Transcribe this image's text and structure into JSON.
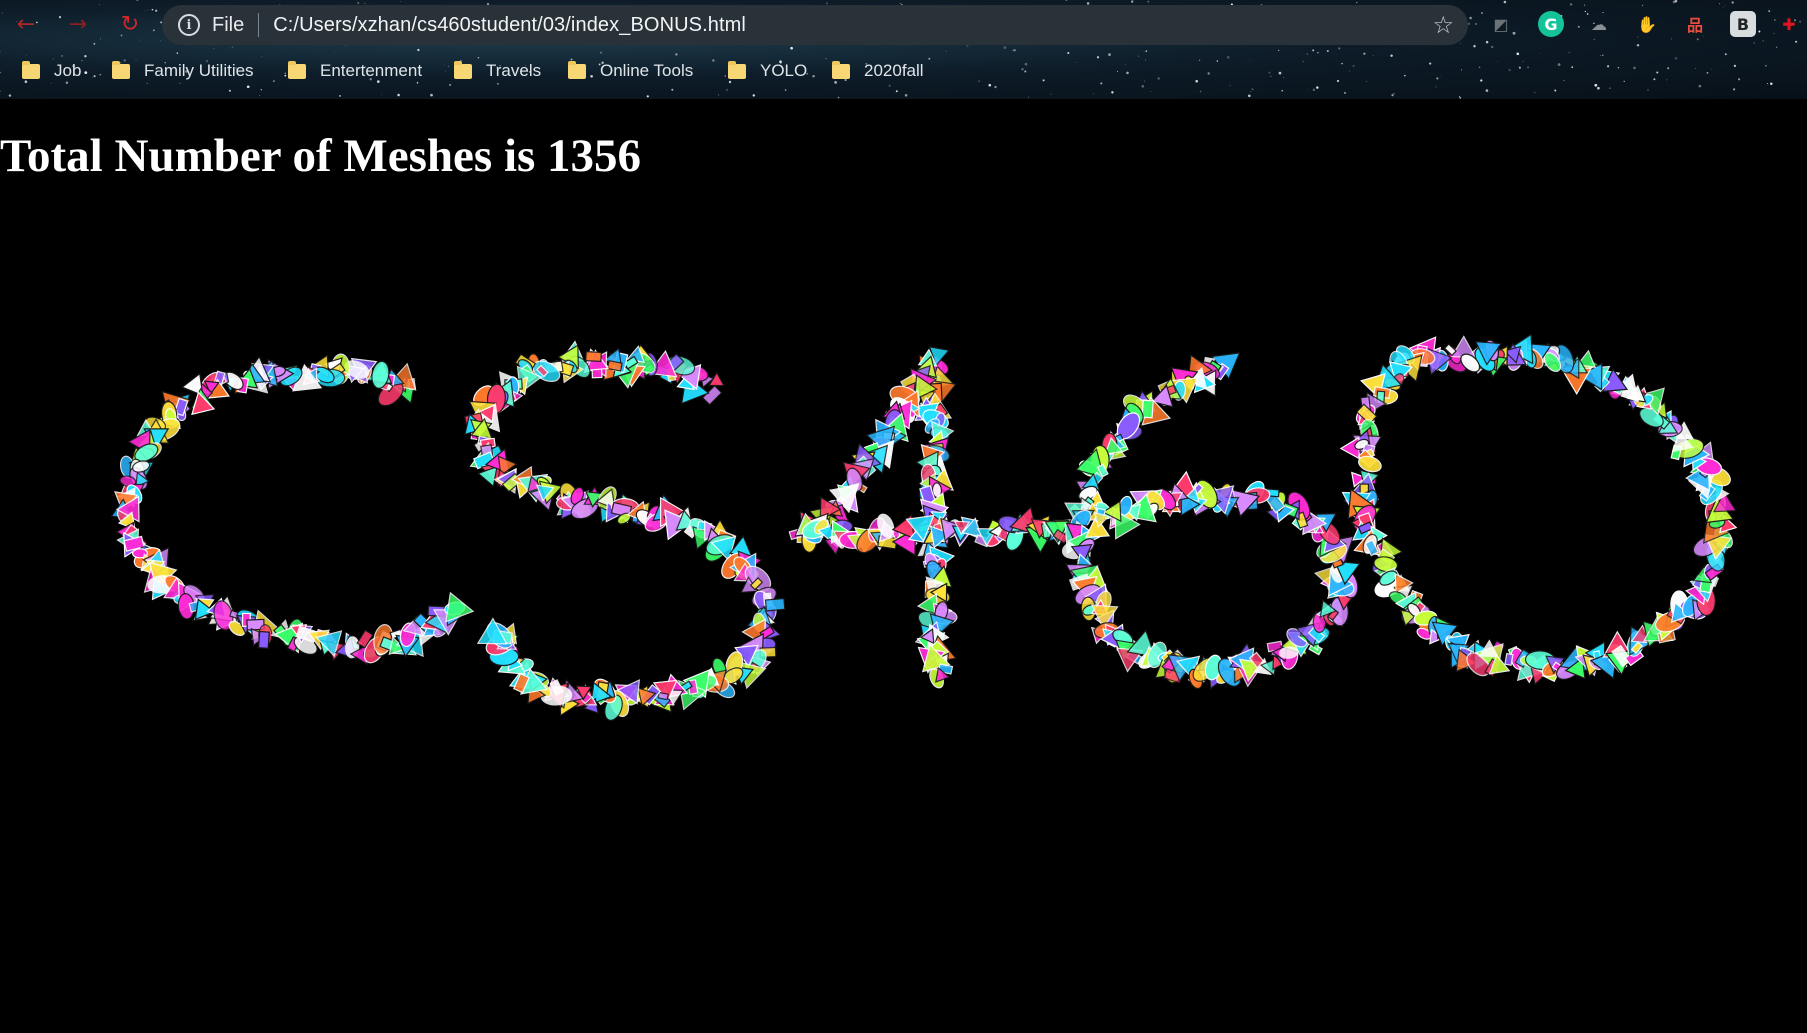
{
  "browser": {
    "scheme_label": "File",
    "url": "C:/Users/xzhan/cs460student/03/index_BONUS.html",
    "nav_icons": [
      "back-arrow-icon",
      "forward-arrow-icon",
      "reload-icon"
    ],
    "extensions": [
      {
        "name": "extension-compass-icon",
        "color": "#6b7378",
        "glyph": "◩"
      },
      {
        "name": "grammarly-icon",
        "color": "#15c39a",
        "glyph": "G"
      },
      {
        "name": "extension-cloud-icon",
        "color": "#8a9096",
        "glyph": "☁"
      },
      {
        "name": "adblock-icon",
        "color": "#d40a0a",
        "glyph": "✋"
      },
      {
        "name": "extension-sitemap-icon",
        "color": "#e84c3d",
        "glyph": "品"
      },
      {
        "name": "extension-b-icon",
        "color": "#d9dcdf",
        "glyph": "B"
      },
      {
        "name": "extensions-puzzle-icon",
        "color": "#e0141e",
        "glyph": "✚"
      }
    ]
  },
  "bookmarks": [
    {
      "label": "Job"
    },
    {
      "label": "Family Utilities"
    },
    {
      "label": "Entertenment"
    },
    {
      "label": "Travels"
    },
    {
      "label": "Online Tools"
    },
    {
      "label": "YOLO"
    },
    {
      "label": "2020fall"
    }
  ],
  "page": {
    "heading": "Total Number of Meshes is 1356"
  },
  "scene": {
    "text": "CS460",
    "mesh_colors": [
      "#ff2bd6",
      "#22e0ff",
      "#ffe23a",
      "#3bff6a",
      "#8a5cff",
      "#ff7a2b",
      "#ffffff",
      "#2bb6ff",
      "#c8ff3a",
      "#ff3b6e",
      "#5cffd9",
      "#d88bff"
    ]
  }
}
